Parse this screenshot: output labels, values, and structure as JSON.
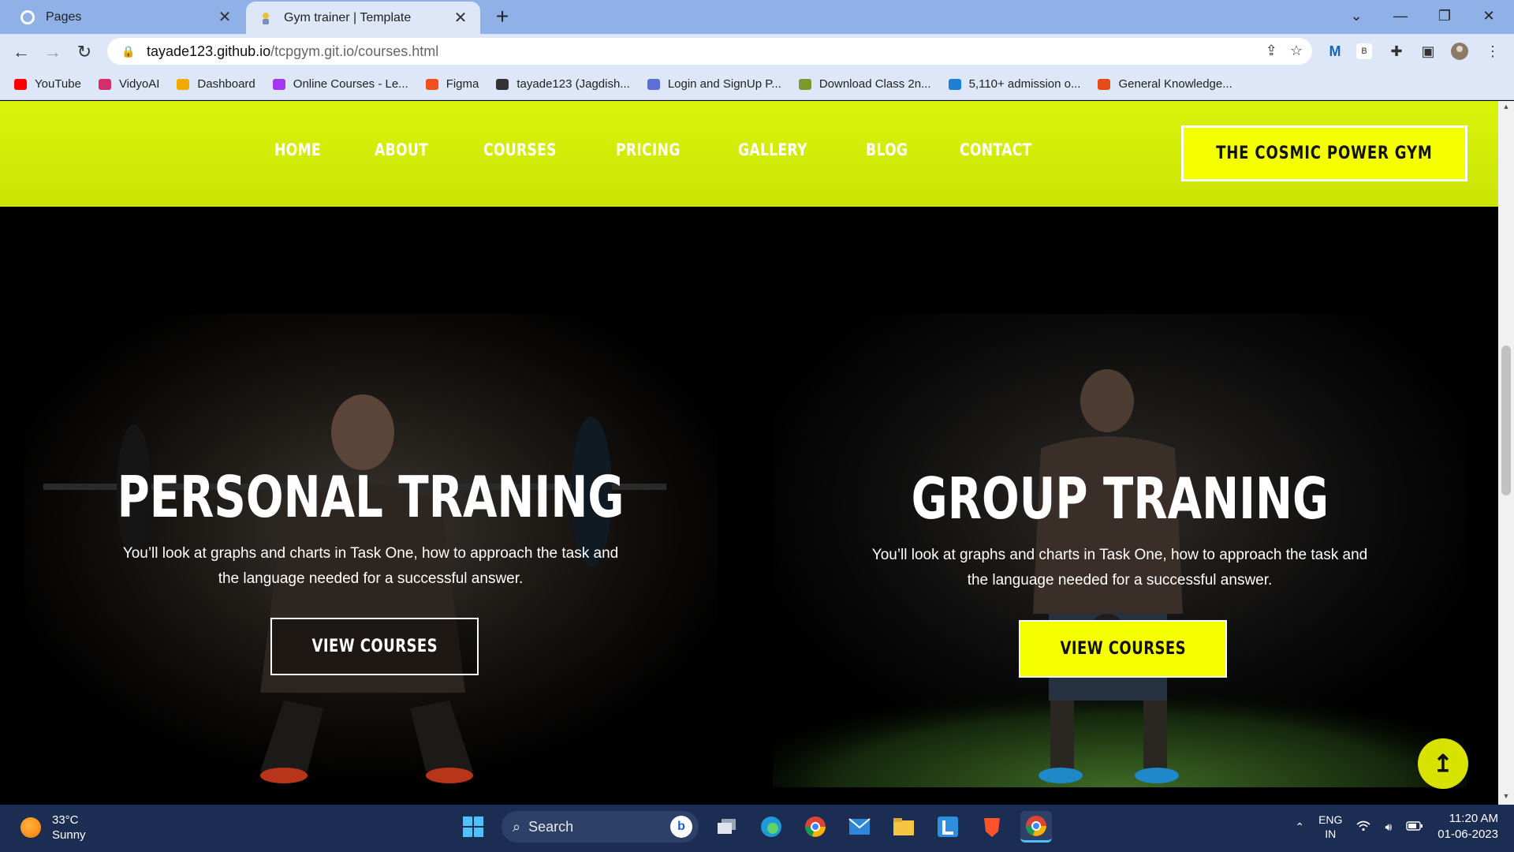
{
  "browser": {
    "tabs": [
      {
        "title": "Pages",
        "active": false,
        "icon": "github-icon"
      },
      {
        "title": "Gym trainer | Template",
        "active": true,
        "icon": "site-favicon-icon"
      }
    ],
    "url_host": "tayade123.github.io",
    "url_path": "/tcpgym.git.io/courses.html",
    "bookmarks": [
      {
        "label": "YouTube",
        "icon": "youtube-icon",
        "color": "#ff0000"
      },
      {
        "label": "VidyoAI",
        "icon": "vidyoai-icon",
        "color": "#d32f6a"
      },
      {
        "label": "Dashboard",
        "icon": "dashboard-icon",
        "color": "#f2a900"
      },
      {
        "label": "Online Courses - Le...",
        "icon": "udemy-icon",
        "color": "#a435f0"
      },
      {
        "label": "Figma",
        "icon": "figma-icon",
        "color": "#f24e1e"
      },
      {
        "label": "tayade123 (Jagdish...",
        "icon": "github-icon",
        "color": "#333333"
      },
      {
        "label": "Login and SignUp P...",
        "icon": "page-icon",
        "color": "#5b6fd6"
      },
      {
        "label": "Download Class 2n...",
        "icon": "doc-icon",
        "color": "#7a9a2b"
      },
      {
        "label": "5,110+ admission o...",
        "icon": "arrow-icon",
        "color": "#1c7fd6"
      },
      {
        "label": "General Knowledge...",
        "icon": "gk-icon",
        "color": "#e64a19"
      }
    ]
  },
  "site": {
    "nav": [
      "HOME",
      "ABOUT",
      "COURSES",
      "PRICING",
      "GALLERY",
      "BLOG",
      "CONTACT"
    ],
    "brand": "THE COSMIC POWER GYM",
    "accent": "#f6ff00",
    "header_color": "#d4ee08",
    "cards": [
      {
        "title": "PERSONAL TRANING",
        "desc_line1": "You’ll look at graphs and charts in Task One, how to approach the task and",
        "desc_line2": "the language needed for a successful answer.",
        "cta": "VIEW COURSES",
        "style": "outline"
      },
      {
        "title": "GROUP TRANING",
        "desc_line1": "You’ll look at graphs and charts in Task One, how to approach the task and",
        "desc_line2": "the language needed for a successful answer.",
        "cta": "VIEW COURSES",
        "style": "solid"
      }
    ],
    "back_to_top_icon": "arrow-up-icon"
  },
  "taskbar": {
    "temp": "33°C",
    "condition": "Sunny",
    "search_label": "Search",
    "lang_top": "ENG",
    "lang_bottom": "IN",
    "time": "11:20 AM",
    "date": "01-06-2023"
  }
}
